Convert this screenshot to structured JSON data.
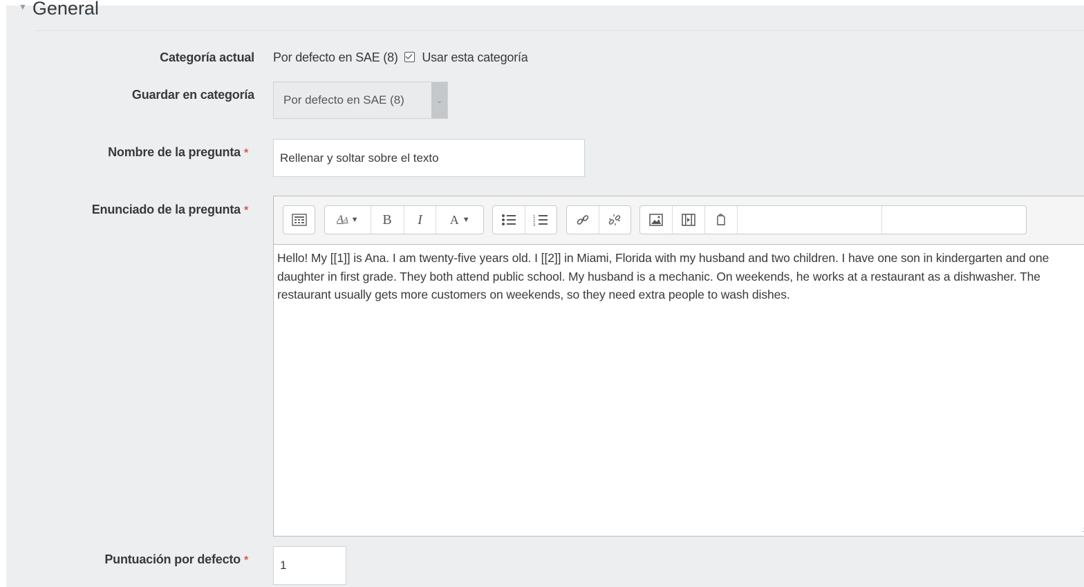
{
  "section": {
    "title": "General"
  },
  "current_category": {
    "label": "Categoría actual",
    "value": "Por defecto en SAE (8)",
    "checkbox_label": "Usar esta categoría",
    "checked": true
  },
  "save_category": {
    "label": "Guardar en categoría",
    "selected": "Por defecto en SAE (8)"
  },
  "question_name": {
    "label": "Nombre de la pregunta",
    "required_mark": "*",
    "value": "Rellenar y soltar sobre el texto"
  },
  "question_text": {
    "label": "Enunciado de la pregunta",
    "required_mark": "*",
    "content": "Hello! My [[1]] is Ana. I am twenty-five years old. I [[2]] in Miami, Florida with my husband and two children. I have one son in kindergarten and one daughter in first grade. They both attend public school. My husband is a mechanic. On weekends, he works at a restaurant as a dishwasher. The restaurant usually gets more customers on weekends, so they need extra people to wash dishes.",
    "toolbar": {
      "toggle_icon": "toolbar-toggle-icon",
      "font_icon": "font-size-icon",
      "bold": "B",
      "italic": "I",
      "style_label": "A",
      "bullet_icon": "unordered-list-icon",
      "number_icon": "ordered-list-icon",
      "link_icon": "link-icon",
      "unlink_icon": "unlink-icon",
      "image_icon": "image-icon",
      "media_icon": "media-icon",
      "manage_files_icon": "manage-files-icon"
    }
  },
  "default_mark": {
    "label": "Puntuación por defecto",
    "required_mark": "*",
    "value": "1"
  }
}
